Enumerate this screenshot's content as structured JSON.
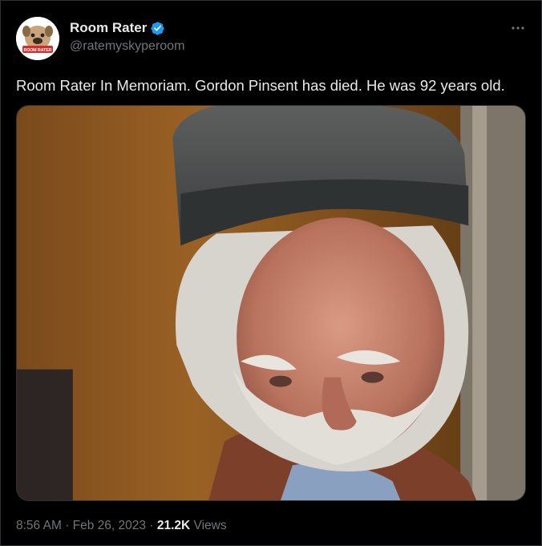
{
  "account": {
    "display_name": "Room Rater",
    "handle": "@ratemyskyperoom",
    "verified": true,
    "avatar_text": "ROOM RATER"
  },
  "tweet": {
    "text": "Room Rater In Memoriam. Gordon Pinsent has died. He was 92 years old.",
    "time": "8:56 AM",
    "separator": "·",
    "date": "Feb 26, 2023",
    "views_count": "21.2K",
    "views_label": "Views"
  },
  "icons": {
    "verified": "verified-badge-icon",
    "more": "more-options-icon"
  },
  "colors": {
    "background": "#000000",
    "text": "#e7e9ea",
    "muted": "#71767b",
    "verified": "#1d9bf0",
    "border": "#2f3336"
  }
}
